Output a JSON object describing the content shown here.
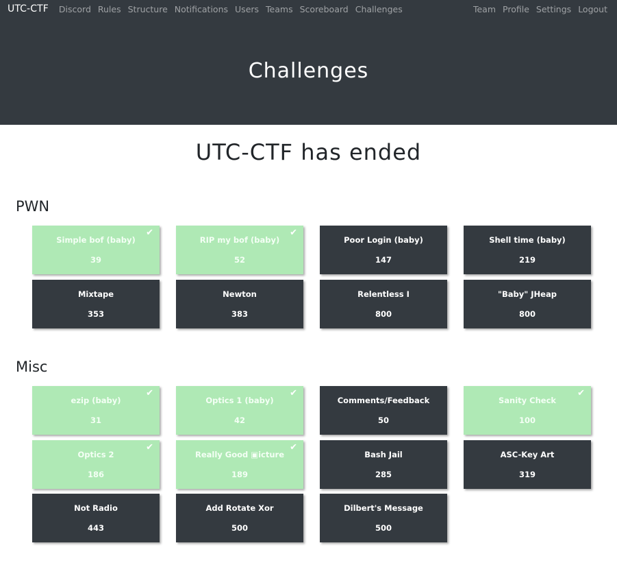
{
  "navbar": {
    "brand": "UTC-CTF",
    "left_links": [
      "Discord",
      "Rules",
      "Structure",
      "Notifications",
      "Users",
      "Teams",
      "Scoreboard",
      "Challenges"
    ],
    "right_links": [
      "Team",
      "Profile",
      "Settings",
      "Logout"
    ]
  },
  "header": {
    "title": "Challenges"
  },
  "notice": "UTC-CTF has ended",
  "categories": [
    {
      "name": "PWN",
      "challenges": [
        {
          "name": "Simple bof (baby)",
          "points": "39",
          "solved": true
        },
        {
          "name": "RIP my bof (baby)",
          "points": "52",
          "solved": true
        },
        {
          "name": "Poor Login (baby)",
          "points": "147",
          "solved": false
        },
        {
          "name": "Shell time (baby)",
          "points": "219",
          "solved": false
        },
        {
          "name": "Mixtape",
          "points": "353",
          "solved": false
        },
        {
          "name": "Newton",
          "points": "383",
          "solved": false
        },
        {
          "name": "Relentless I",
          "points": "800",
          "solved": false
        },
        {
          "name": "\"Baby\" JHeap",
          "points": "800",
          "solved": false
        }
      ]
    },
    {
      "name": "Misc",
      "challenges": [
        {
          "name": "ezip (baby)",
          "points": "31",
          "solved": true
        },
        {
          "name": "Optics 1 (baby)",
          "points": "42",
          "solved": true
        },
        {
          "name": "Comments/Feedback",
          "points": "50",
          "solved": false
        },
        {
          "name": "Sanity Check",
          "points": "100",
          "solved": true
        },
        {
          "name": "Optics 2",
          "points": "186",
          "solved": true
        },
        {
          "name": "Really Good ▣icture",
          "points": "189",
          "solved": true
        },
        {
          "name": "Bash Jail",
          "points": "285",
          "solved": false
        },
        {
          "name": "ASC-Key Art",
          "points": "319",
          "solved": false
        },
        {
          "name": "Not Radio",
          "points": "443",
          "solved": false
        },
        {
          "name": "Add Rotate Xor",
          "points": "500",
          "solved": false
        },
        {
          "name": "Dilbert's Message",
          "points": "500",
          "solved": false
        }
      ]
    }
  ],
  "icons": {
    "solved": "checkmark-icon"
  },
  "colors": {
    "navbar": "#343a40",
    "solved": "#afe9b5",
    "unsolved": "#343a40"
  }
}
